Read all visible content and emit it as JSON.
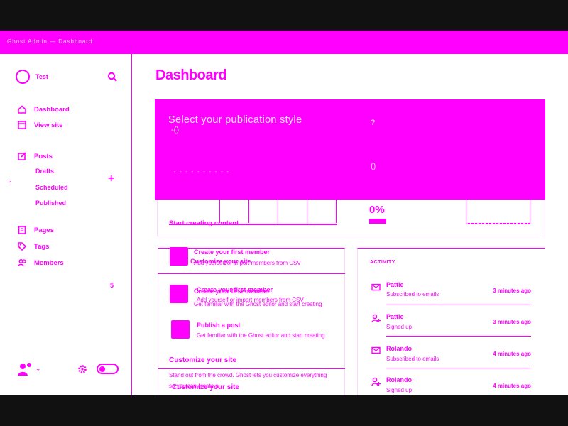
{
  "topbar": {
    "text": "Ghost Admin — Dashboard"
  },
  "sidebar": {
    "site_name": "Test",
    "nav": [
      {
        "label": "Dashboard",
        "icon": "home-icon"
      },
      {
        "label": "View site",
        "icon": "browser-icon"
      },
      {
        "label": "Posts",
        "icon": "edit-icon"
      },
      {
        "label": "Drafts"
      },
      {
        "label": "Scheduled"
      },
      {
        "label": "Published"
      },
      {
        "label": "Pages",
        "icon": "page-icon"
      },
      {
        "label": "Tags",
        "icon": "tag-icon"
      },
      {
        "label": "Members",
        "icon": "members-icon"
      }
    ],
    "members_count": "5"
  },
  "main": {
    "title": "Dashboard",
    "publication_style": {
      "title": "Select your publication style",
      "glyph_a": "-()",
      "glyph_b": "?",
      "glyph_c": "()",
      "subtitle": "- - - - - - - - - -"
    },
    "start": {
      "title": "Start creating content",
      "percent": "0%",
      "progress": 0
    },
    "tasks": [
      {
        "title": "Create your first member",
        "desc": "Add yourself or import members from CSV"
      },
      {
        "title": "Publish a post",
        "desc": "Get familiar with the Ghost editor and start creating"
      },
      {
        "title": "Customize your site",
        "desc": "Stand out from the crowd. Ghost lets you customize everything so you can create a"
      }
    ],
    "ghost_tasks": {
      "member_a": "Create your first member",
      "member_b": "Create your first member",
      "sub_a": "Add yourself or import members from CSV",
      "sub_b": "Add yourself or import members from CSV",
      "customize_b": "Customize your site"
    },
    "activity": {
      "heading": "ACTIVITY",
      "items": [
        {
          "name": "Pattie",
          "desc": "Subscribed to emails",
          "time": "3 minutes ago",
          "icon": "mail-icon"
        },
        {
          "name": "Pattie",
          "desc": "Signed up",
          "time": "3 minutes ago",
          "icon": "user-plus-icon"
        },
        {
          "name": "Rolando",
          "desc": "Subscribed to emails",
          "time": "4 minutes ago",
          "icon": "mail-icon"
        },
        {
          "name": "Rolando",
          "desc": "Signed up",
          "time": "4 minutes ago",
          "icon": "user-plus-icon"
        }
      ]
    }
  },
  "colors": {
    "accent": "#ff00ff",
    "background": "#ffffff",
    "letterbox": "#111111"
  }
}
